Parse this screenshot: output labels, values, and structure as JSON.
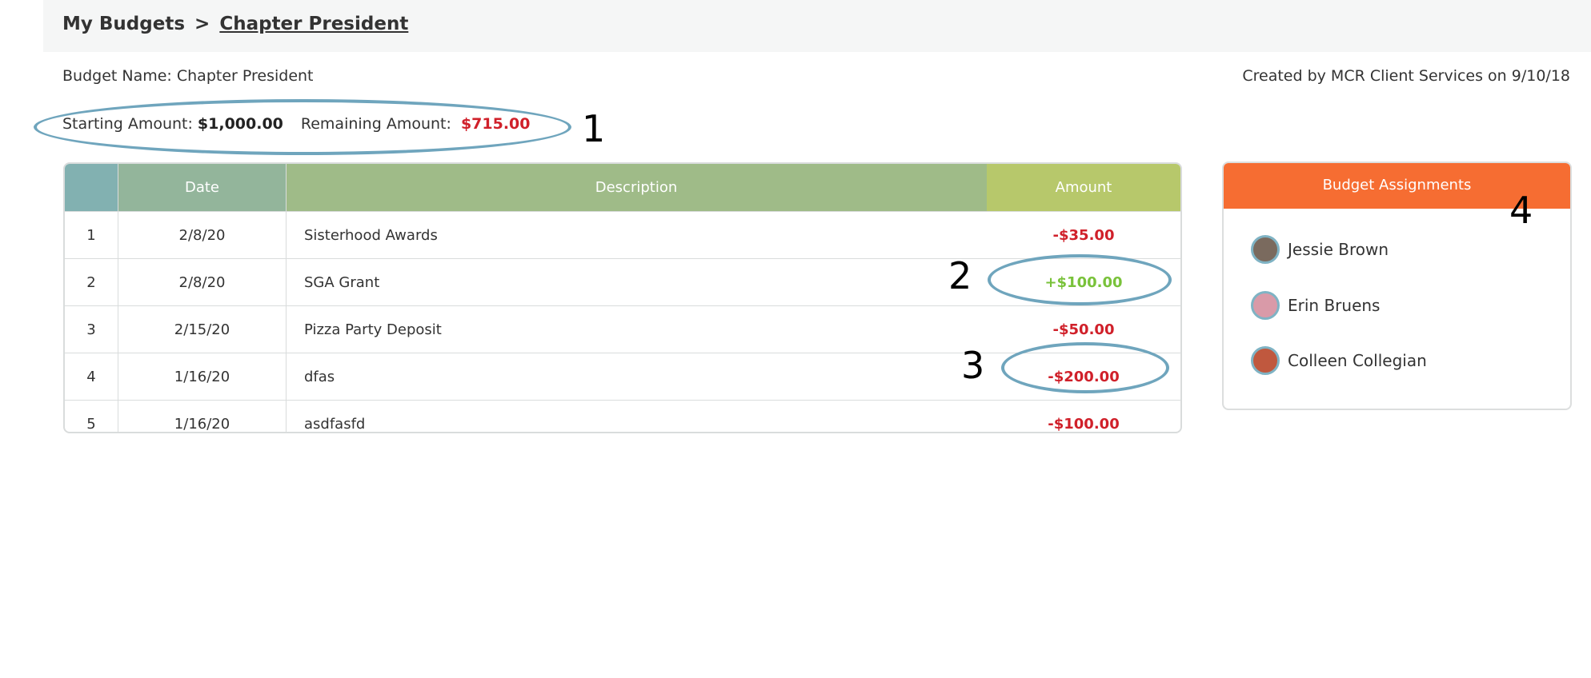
{
  "breadcrumb": {
    "root": "My Budgets",
    "separator": ">",
    "current": "Chapter President"
  },
  "budget": {
    "name_label": "Budget Name: Chapter President",
    "created_by": "Created by MCR Client Services on 9/10/18",
    "starting_label": "Starting Amount:",
    "starting_value": "$1,000.00",
    "remaining_label": "Remaining Amount:",
    "remaining_value": "$715.00"
  },
  "table": {
    "headers": {
      "num": "",
      "date": "Date",
      "description": "Description",
      "amount": "Amount"
    },
    "rows": [
      {
        "num": "1",
        "date": "2/8/20",
        "description": "Sisterhood Awards",
        "amount": "-$35.00",
        "type": "negative"
      },
      {
        "num": "2",
        "date": "2/8/20",
        "description": "SGA Grant",
        "amount": "+$100.00",
        "type": "positive"
      },
      {
        "num": "3",
        "date": "2/15/20",
        "description": "Pizza Party Deposit",
        "amount": "-$50.00",
        "type": "negative"
      },
      {
        "num": "4",
        "date": "1/16/20",
        "description": "dfas",
        "amount": "-$200.00",
        "type": "negative"
      },
      {
        "num": "5",
        "date": "1/16/20",
        "description": "asdfasfd",
        "amount": "-$100.00",
        "type": "negative"
      }
    ]
  },
  "assignments": {
    "title": "Budget Assignments",
    "people": [
      {
        "name": "Jessie Brown"
      },
      {
        "name": "Erin Bruens"
      },
      {
        "name": "Colleen Collegian"
      }
    ]
  },
  "annotations": {
    "m1": "1",
    "m2": "2",
    "m3": "3",
    "m4": "4"
  },
  "colors": {
    "accent_orange": "#f66d32",
    "negative_red": "#d0202a",
    "positive_green": "#79c23a",
    "annotation_ring": "#6fa5bd"
  }
}
